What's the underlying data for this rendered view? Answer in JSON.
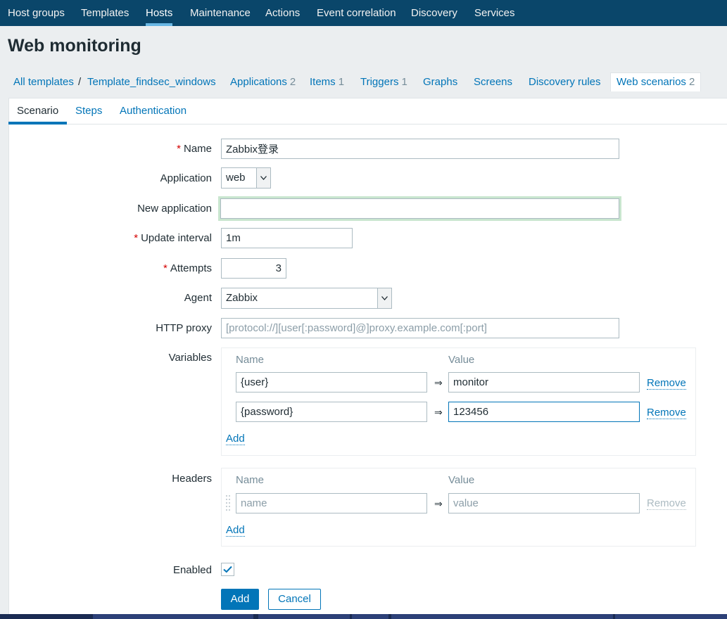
{
  "topnav": {
    "items": [
      "Host groups",
      "Templates",
      "Hosts",
      "Maintenance",
      "Actions",
      "Event correlation",
      "Discovery",
      "Services"
    ],
    "active": "Hosts"
  },
  "page_title": "Web monitoring",
  "breadcrumb": {
    "all_templates": "All templates",
    "separator": "/",
    "template": "Template_findsec_windows"
  },
  "header_tabs": [
    {
      "label": "Applications",
      "count": "2"
    },
    {
      "label": "Items",
      "count": "1"
    },
    {
      "label": "Triggers",
      "count": "1"
    },
    {
      "label": "Graphs",
      "count": ""
    },
    {
      "label": "Screens",
      "count": ""
    },
    {
      "label": "Discovery rules",
      "count": ""
    },
    {
      "label": "Web scenarios",
      "count": "2"
    }
  ],
  "subtabs": [
    "Scenario",
    "Steps",
    "Authentication"
  ],
  "form": {
    "name_label": "Name",
    "name_value": "Zabbix登录",
    "application_label": "Application",
    "application_value": "web",
    "new_application_label": "New application",
    "new_application_value": "",
    "update_interval_label": "Update interval",
    "update_interval_value": "1m",
    "attempts_label": "Attempts",
    "attempts_value": "3",
    "agent_label": "Agent",
    "agent_value": "Zabbix",
    "http_proxy_label": "HTTP proxy",
    "http_proxy_placeholder": "[protocol://][user[:password]@]proxy.example.com[:port]",
    "variables_label": "Variables",
    "headers_label": "Headers",
    "enabled_label": "Enabled",
    "enabled": true,
    "col_name": "Name",
    "col_value": "Value",
    "arrow": "⇒",
    "remove": "Remove",
    "add_link": "Add",
    "variables": [
      {
        "name": "{user}",
        "value": "monitor"
      },
      {
        "name": "{password}",
        "value": "123456"
      }
    ],
    "headers": [
      {
        "name_placeholder": "name",
        "value_placeholder": "value"
      }
    ]
  },
  "buttons": {
    "add": "Add",
    "cancel": "Cancel"
  },
  "colors": {
    "nav_bg": "#0a466a",
    "link": "#0275b8",
    "required": "#d40000"
  }
}
